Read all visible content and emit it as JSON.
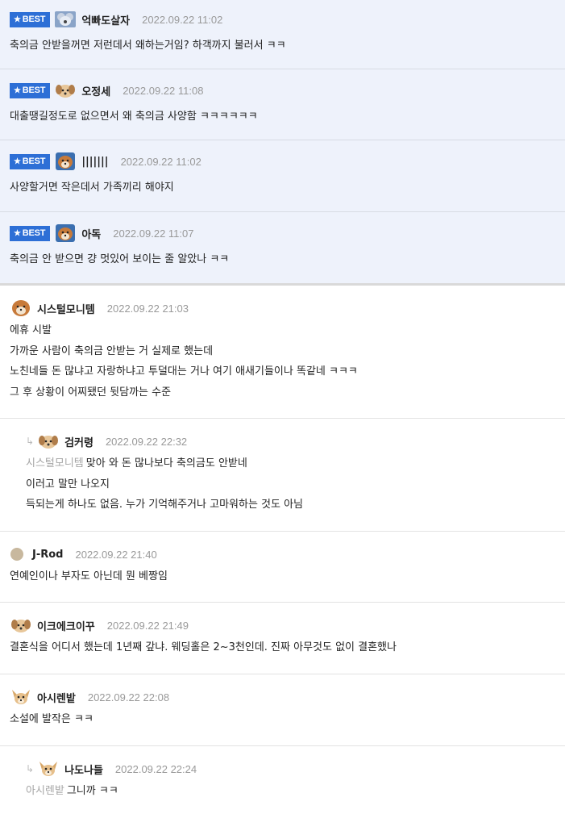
{
  "best_label": "BEST",
  "best_comments": [
    {
      "nick": "억빠도살자",
      "date": "2022.09.22 11:02",
      "avatar_icon": "koala-avatar-icon",
      "lines": [
        "축의금 안받을꺼면 저런데서 왜하는거임? 하객까지 불러서 ㅋㅋ"
      ]
    },
    {
      "nick": "오정세",
      "date": "2022.09.22 11:08",
      "avatar_icon": "puppy-avatar-icon",
      "lines": [
        "대출땡길정도로 없으면서 왜 축의금 사양함 ㅋㅋㅋㅋㅋㅋ"
      ]
    },
    {
      "nick": "|||||||",
      "date": "2022.09.22 11:02",
      "avatar_icon": "shiba-avatar-icon",
      "lines": [
        "사양할거면 작은데서 가족끼리 해야지"
      ]
    },
    {
      "nick": "아독",
      "date": "2022.09.22 11:07",
      "avatar_icon": "shiba-avatar-icon",
      "lines": [
        "축의금 안 받으면 걍 멋있어 보이는 줄 알았나 ㅋㅋ"
      ]
    }
  ],
  "comments": [
    {
      "type": "comment",
      "nick": "시스털모니템",
      "date": "2022.09.22 21:03",
      "avatar_icon": "shiba-avatar-icon",
      "mention": "",
      "lines": [
        "에휴 시발",
        "가까운 사람이 축의금 안받는 거 실제로 했는데",
        "노친네들 돈 많냐고 자랑하냐고 투덜대는 거나 여기 애새기들이나 똑같네 ㅋㅋㅋ",
        "그 후 상황이 어찌됐던 뒷담까는 수준"
      ]
    },
    {
      "type": "reply",
      "nick": "검커령",
      "date": "2022.09.22 22:32",
      "avatar_icon": "puppy-avatar-icon",
      "mention": "시스털모니템",
      "lines": [
        "맞아 와 돈 많나보다 축의금도 안받네",
        "이러고 말만 나오지",
        "득되는게 하나도 없음. 누가 기억해주거나 고마워하는 것도 아님"
      ]
    },
    {
      "type": "comment",
      "nick": "J-Rod",
      "date": "2022.09.22 21:40",
      "avatar_icon": "dot-avatar-icon",
      "mention": "",
      "lines": [
        "연예인이나 부자도 아닌데 뭔 베짱임"
      ]
    },
    {
      "type": "comment",
      "nick": "이크에크이꾸",
      "date": "2022.09.22 21:49",
      "avatar_icon": "puppy-avatar-icon",
      "mention": "",
      "lines": [
        "결혼식을 어디서 했는데 1년째 갚냐. 웨딩홀은 2~3천인데. 진짜 아무것도 없이 결혼했나"
      ]
    },
    {
      "type": "comment",
      "nick": "아시렌밭",
      "date": "2022.09.22 22:08",
      "avatar_icon": "chihuahua-avatar-icon",
      "mention": "",
      "lines": [
        "소설에 발작은 ㅋㅋ"
      ]
    },
    {
      "type": "reply",
      "nick": "나도나들",
      "date": "2022.09.22 22:24",
      "avatar_icon": "chihuahua-avatar-icon",
      "mention": "아시렌밭",
      "lines": [
        "그니까 ㅋㅋ"
      ]
    }
  ],
  "colors": {
    "best_badge": "#2d6fd6",
    "best_bg": "#eef2fb",
    "date": "#999999",
    "mention": "#a5a5a5"
  }
}
